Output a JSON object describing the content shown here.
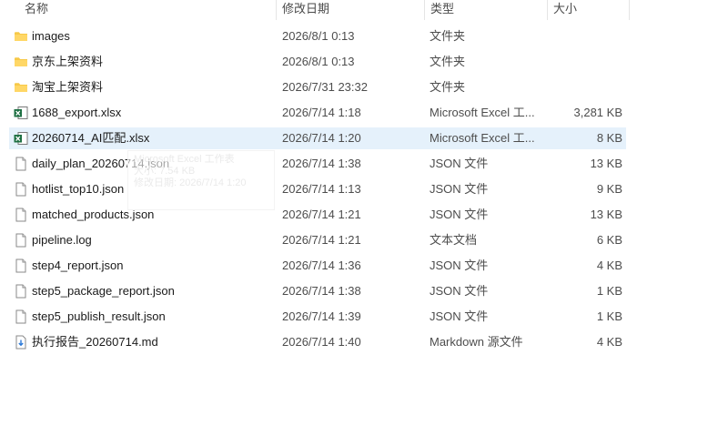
{
  "columns": {
    "name": "名称",
    "modified": "修改日期",
    "type": "类型",
    "size": "大小"
  },
  "files": [
    {
      "name": "images",
      "modified": "2026/8/1 0:13",
      "type": "文件夹",
      "size": "",
      "icon": "folder-icon"
    },
    {
      "name": "京东上架资料",
      "modified": "2026/8/1 0:13",
      "type": "文件夹",
      "size": "",
      "icon": "folder-icon"
    },
    {
      "name": "淘宝上架资料",
      "modified": "2026/7/31 23:32",
      "type": "文件夹",
      "size": "",
      "icon": "folder-icon"
    },
    {
      "name": "1688_export.xlsx",
      "modified": "2026/7/14 1:18",
      "type": "Microsoft Excel 工...",
      "size": "3,281 KB",
      "icon": "excel-icon"
    },
    {
      "name": "20260714_AI匹配.xlsx",
      "modified": "2026/7/14 1:20",
      "type": "Microsoft Excel 工...",
      "size": "8 KB",
      "icon": "excel-icon",
      "selected": true
    },
    {
      "name": "daily_plan_20260714.json",
      "modified": "2026/7/14 1:38",
      "type": "JSON 文件",
      "size": "13 KB",
      "icon": "document-icon"
    },
    {
      "name": "hotlist_top10.json",
      "modified": "2026/7/14 1:13",
      "type": "JSON 文件",
      "size": "9 KB",
      "icon": "document-icon"
    },
    {
      "name": "matched_products.json",
      "modified": "2026/7/14 1:21",
      "type": "JSON 文件",
      "size": "13 KB",
      "icon": "document-icon"
    },
    {
      "name": "pipeline.log",
      "modified": "2026/7/14 1:21",
      "type": "文本文档",
      "size": "6 KB",
      "icon": "document-icon"
    },
    {
      "name": "step4_report.json",
      "modified": "2026/7/14 1:36",
      "type": "JSON 文件",
      "size": "4 KB",
      "icon": "document-icon"
    },
    {
      "name": "step5_package_report.json",
      "modified": "2026/7/14 1:38",
      "type": "JSON 文件",
      "size": "1 KB",
      "icon": "document-icon"
    },
    {
      "name": "step5_publish_result.json",
      "modified": "2026/7/14 1:39",
      "type": "JSON 文件",
      "size": "1 KB",
      "icon": "document-icon"
    },
    {
      "name": "执行报告_20260714.md",
      "modified": "2026/7/14 1:40",
      "type": "Markdown 源文件",
      "size": "4 KB",
      "icon": "markdown-icon"
    }
  ],
  "tooltip": {
    "line1": "Microsoft Excel 工作表",
    "line2": "大小: 7.54 KB",
    "line3": "修改日期: 2026/7/14 1:20"
  },
  "colors": {
    "selection": "#e5f1fb",
    "folder": "#f7c948",
    "excel": "#1d6f42"
  }
}
